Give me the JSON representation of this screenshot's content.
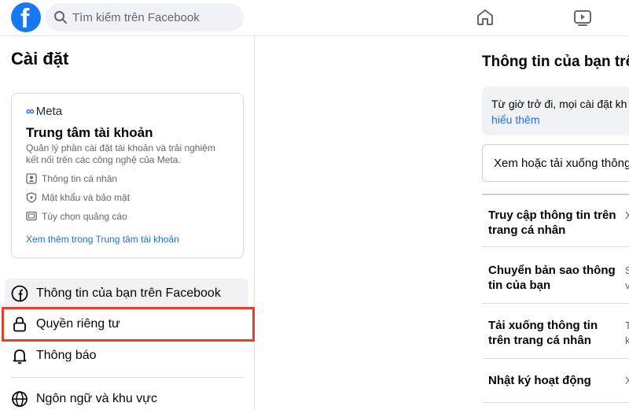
{
  "topbar": {
    "logo_letter": "f",
    "search_placeholder": "Tìm kiếm trên Facebook"
  },
  "sidebar": {
    "title": "Cài đặt",
    "account_center": {
      "brand": "Meta",
      "title": "Trung tâm tài khoản",
      "description": "Quản lý phần cài đặt tài khoản và trải nghiệm kết nối trên các công nghệ của Meta.",
      "items": [
        {
          "label": "Thông tin cá nhân",
          "icon": "id-card-icon"
        },
        {
          "label": "Mật khẩu và bảo mật",
          "icon": "shield-icon"
        },
        {
          "label": "Tùy chọn quảng cáo",
          "icon": "monitor-icon"
        }
      ],
      "link": "Xem thêm trong Trung tâm tài khoản"
    },
    "items": [
      {
        "label": "Thông tin của bạn trên Facebook",
        "icon": "facebook-icon"
      },
      {
        "label": "Quyền riêng tư",
        "icon": "lock-icon"
      },
      {
        "label": "Thông báo",
        "icon": "bell-icon"
      },
      {
        "label": "Ngôn ngữ và khu vực",
        "icon": "globe-icon"
      }
    ],
    "highlight_color": "#e0412b"
  },
  "main": {
    "title": "Thông tin của bạn trên",
    "notice_text": "Từ giờ trở đi, mọi cài đặt kh",
    "notice_link": "hiểu thêm",
    "view_download": "Xem hoặc tải xuống thông",
    "rows": [
      {
        "label": "Truy cập thông tin trên trang cá nhân",
        "right": "X"
      },
      {
        "label": "Chuyển bản sao thông tin của bạn",
        "right": "S\nv"
      },
      {
        "label": "Tải xuống thông tin trên trang cá nhân",
        "right": "T\nk"
      },
      {
        "label": "Nhật ký hoạt động",
        "right": "X"
      }
    ]
  },
  "colors": {
    "brand": "#1877f2",
    "link": "#216fdb"
  }
}
